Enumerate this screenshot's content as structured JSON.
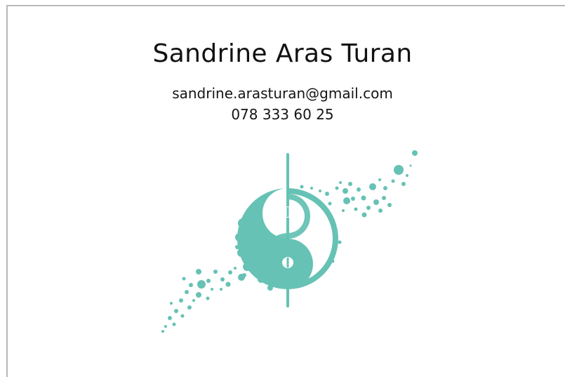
{
  "contact": {
    "name": "Sandrine Aras Turan",
    "email": "sandrine.arasturan@gmail.com",
    "phone": "078 333 60 25"
  },
  "logo": {
    "icon": "yin-yang-splatter-icon",
    "color": "#66c2b4"
  }
}
